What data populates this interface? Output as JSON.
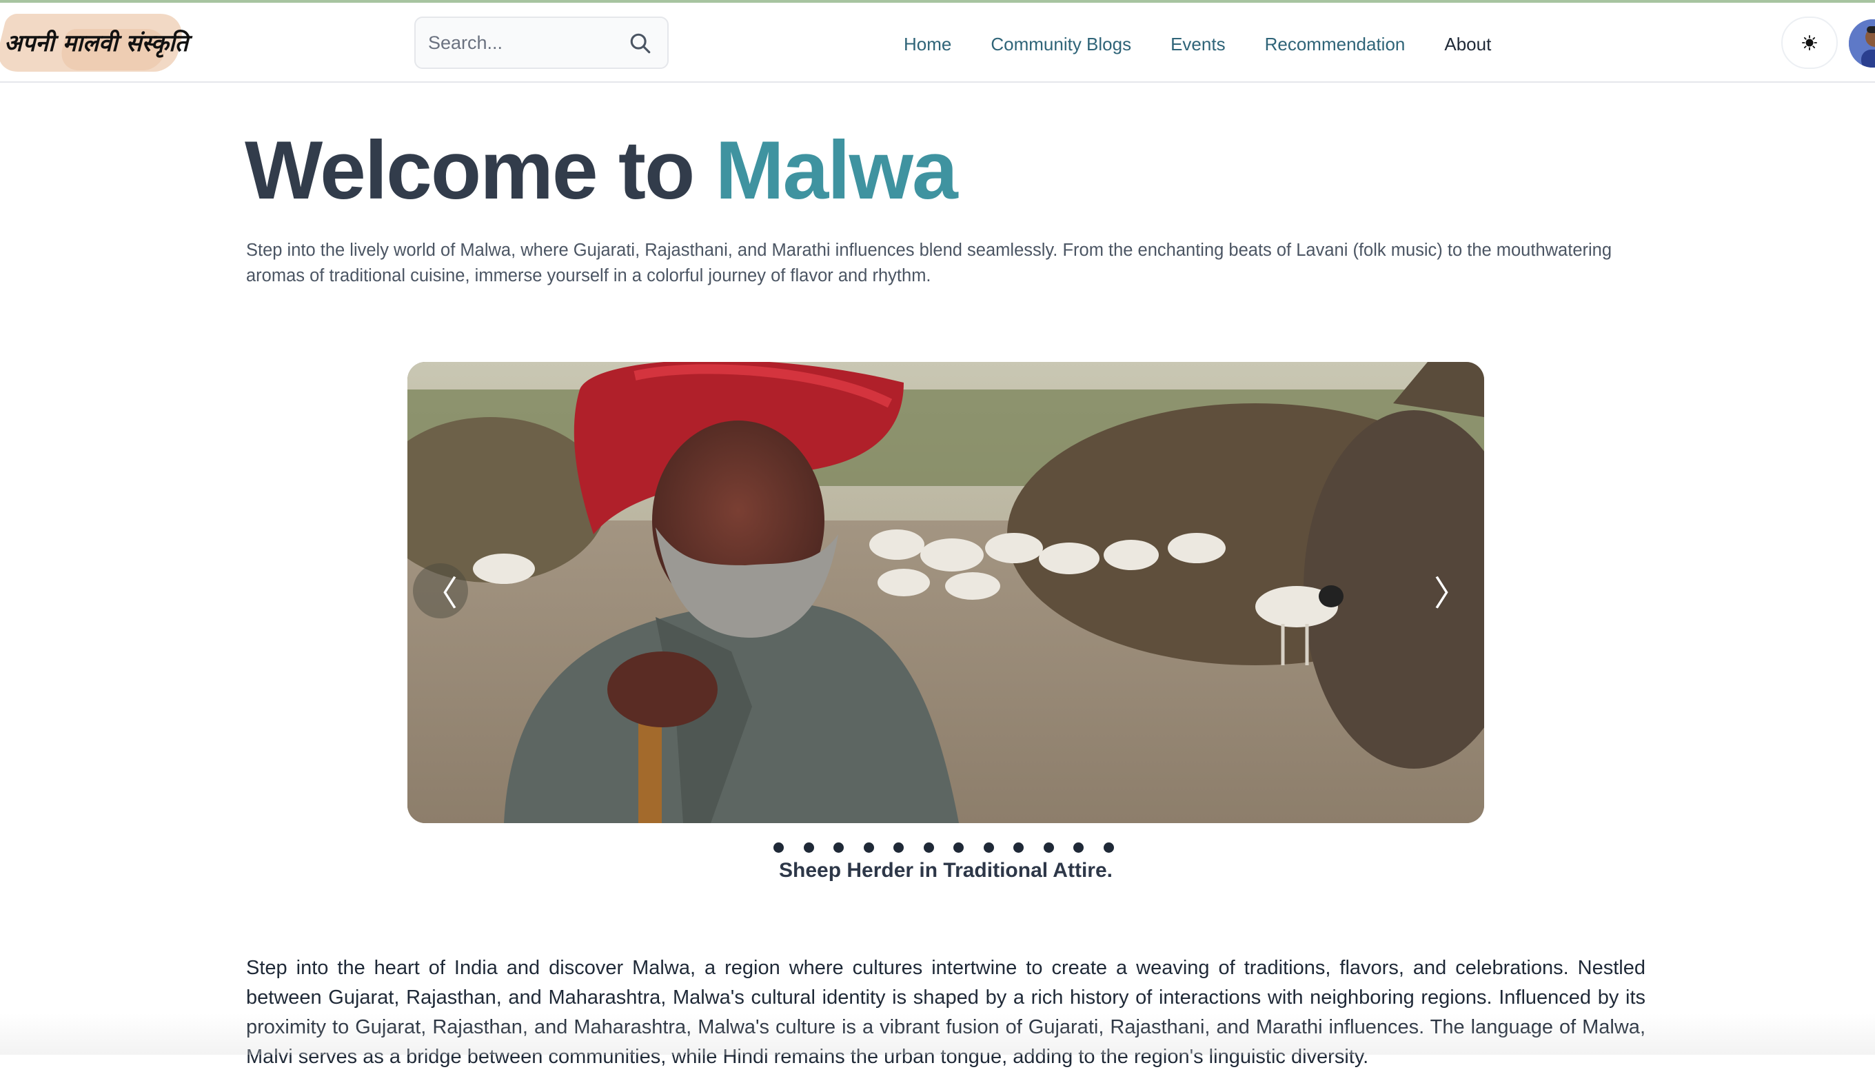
{
  "navbar": {
    "logo_text": "अपनी मालवी संस्कृति",
    "search": {
      "placeholder": "Search..."
    },
    "links": [
      "Home",
      "Community Blogs",
      "Events",
      "Recommendation",
      "About"
    ],
    "theme_toggle_icon": "sun-icon"
  },
  "hero": {
    "title_prefix": "Welcome to ",
    "title_accent": "Malwa",
    "intro": "Step into the lively world of Malwa, where Gujarati, Rajasthani, and Marathi influences blend seamlessly. From the enchanting beats of Lavani (folk music) to the mouthwatering aromas of traditional cuisine, immerse yourself in a colorful journey of flavor and rhythm."
  },
  "carousel": {
    "prev_icon": "chevron-left-icon",
    "next_icon": "chevron-right-icon",
    "slide_count": 12,
    "caption": "Sheep Herder in Traditional Attire."
  },
  "about": {
    "paragraph": "Step into the heart of India and discover Malwa, a region where cultures intertwine to create a weaving of traditions, flavors, and celebrations. Nestled between Gujarat, Rajasthan, and Maharashtra, Malwa's cultural identity is shaped by a rich history of interactions with neighboring regions. Influenced by its proximity to Gujarat, Rajasthan, and Maharashtra, Malwa's culture is a vibrant fusion of Gujarati, Rajasthani, and Marathi influences. The language of Malwa, Malvi serves as a bridge between communities, while Hindi remains the urban tongue, adding to the region's linguistic diversity."
  },
  "colors": {
    "accent": "#3f93a0",
    "nav_link": "#2f6478",
    "heading": "#323c4b"
  }
}
